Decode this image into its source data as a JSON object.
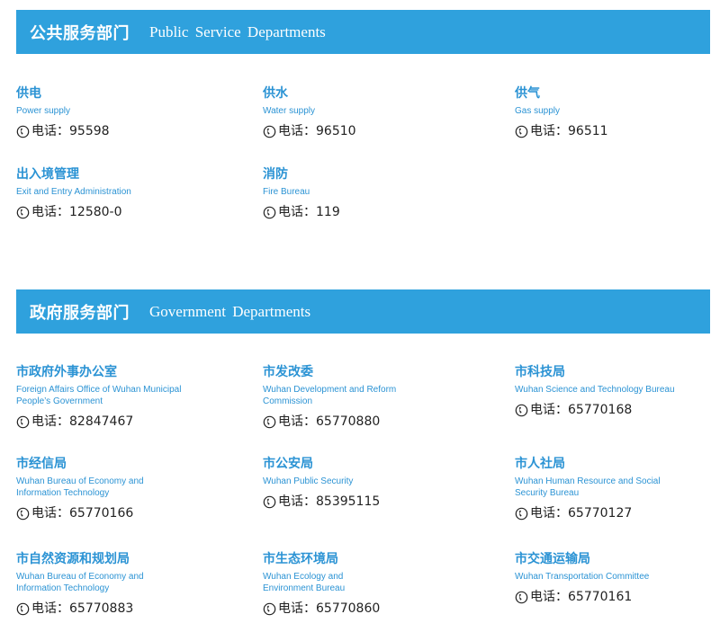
{
  "sections": [
    {
      "title_zh": "公共服务部门",
      "title_en": "Public Service Departments",
      "items": [
        {
          "name": "供电",
          "en": "Power supply",
          "phone": "电话：95598"
        },
        {
          "name": "供水",
          "en": "Water supply",
          "phone": "电话：96510"
        },
        {
          "name": "供气",
          "en": "Gas supply",
          "phone": "电话：96511"
        },
        {
          "name": "出入境管理",
          "en": "Exit and Entry Administration",
          "phone": "电话：12580-0"
        },
        {
          "name": "消防",
          "en": "Fire Bureau",
          "phone": "电话：119"
        }
      ]
    },
    {
      "title_zh": "政府服务部门",
      "title_en": "Government Departments",
      "items": [
        {
          "name": "市政府外事办公室",
          "en": "Foreign Affairs Office of Wuhan Municipal\nPeople’s Government",
          "phone": "电话：82847467"
        },
        {
          "name": "市发改委",
          "en": "Wuhan Development and Reform\nCommission",
          "phone": "电话：65770880"
        },
        {
          "name": "市科技局",
          "en": "Wuhan Science and Technology Bureau",
          "phone": "电话：65770168"
        },
        {
          "name": "市经信局",
          "en": "Wuhan Bureau of Economy and\nInformation Technology",
          "phone": "电话：65770166"
        },
        {
          "name": "市公安局",
          "en": "Wuhan Public Security",
          "phone": "电话：85395115"
        },
        {
          "name": "市人社局",
          "en": "Wuhan Human Resource and Social\nSecurity Bureau",
          "phone": "电话：65770127"
        },
        {
          "name": "市自然资源和规划局",
          "en": "Wuhan Bureau of Economy and\nInformation Technology",
          "phone": "电话：65770883"
        },
        {
          "name": "市生态环境局",
          "en": "Wuhan Ecology and\nEnvironment Bureau",
          "phone": "电话：65770860"
        },
        {
          "name": "市交通运输局",
          "en": "Wuhan Transportation Committee",
          "phone": "电话：65770161"
        }
      ]
    }
  ],
  "icons": {
    "phone": "phone-handset-circle-icon"
  },
  "colors": {
    "banner": "#2fa1dd",
    "accent": "#2b93d4",
    "text": "#222222"
  }
}
